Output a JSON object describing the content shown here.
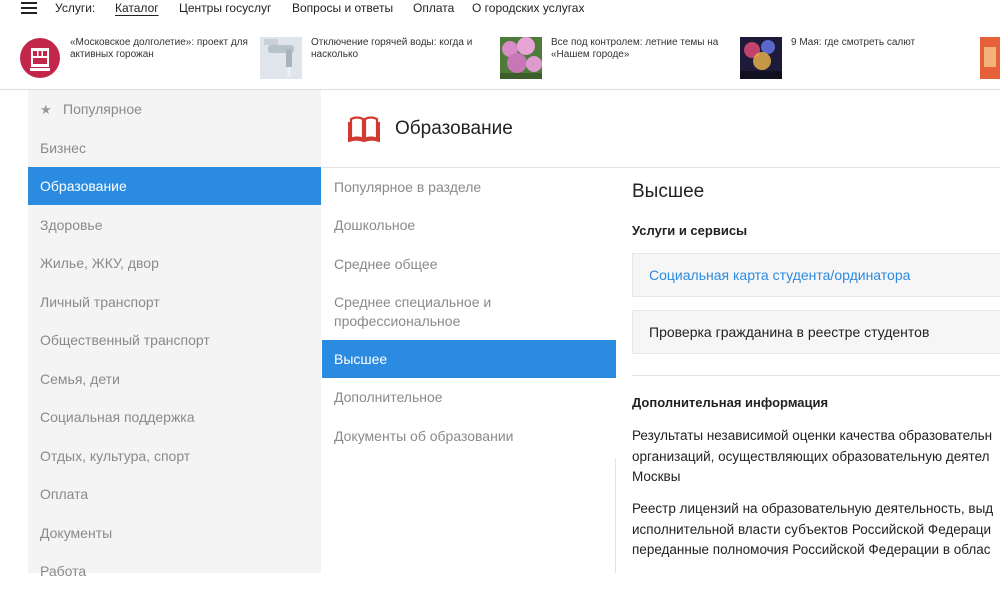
{
  "topnav": {
    "services_label": "Услуги:",
    "items": [
      "Каталог",
      "Центры госуслуг",
      "Вопросы и ответы",
      "Оплата",
      "О городских услугах"
    ]
  },
  "news": [
    {
      "text": "«Московское долголетие»: проект для активных горожан"
    },
    {
      "text": "Отключение горячей воды: когда и насколько"
    },
    {
      "text": "Все под контролем: летние темы на «Нашем городе»"
    },
    {
      "text": "9 Мая: где смотреть салют"
    }
  ],
  "sidebar": {
    "items": [
      "Популярное",
      "Бизнес",
      "Образование",
      "Здоровье",
      "Жилье, ЖКУ, двор",
      "Личный транспорт",
      "Общественный транспорт",
      "Семья, дети",
      "Социальная поддержка",
      "Отдых, культура, спорт",
      "Оплата",
      "Документы",
      "Работа"
    ],
    "active_index": 2
  },
  "section": {
    "title": "Образование",
    "icon": "book-icon"
  },
  "subnav": {
    "items": [
      "Популярное в разделе",
      "Дошкольное",
      "Среднее общее",
      "Среднее специальное и профессиональное",
      "Высшее",
      "Дополнительное",
      "Документы об образовании"
    ],
    "active_index": 4
  },
  "content": {
    "heading": "Высшее",
    "services_heading": "Услуги и сервисы",
    "services": [
      "Социальная карта студента/ординатора",
      "Проверка гражданина в реестре студентов"
    ],
    "info_heading": "Дополнительная информация",
    "paragraph1": "Результаты независимой оценки качества образовательн\nорганизаций, осуществляющих образовательную деятел\nМосквы",
    "paragraph2": "Реестр лицензий на образовательную деятельность, выд\nисполнительной власти субъектов Российской Федераци\nпереданные полномочия Российской Федерации в облас"
  },
  "colors": {
    "accent": "#2b8be0",
    "sidebar_bg": "#f4f4f4",
    "book_icon": "#d2392f"
  }
}
